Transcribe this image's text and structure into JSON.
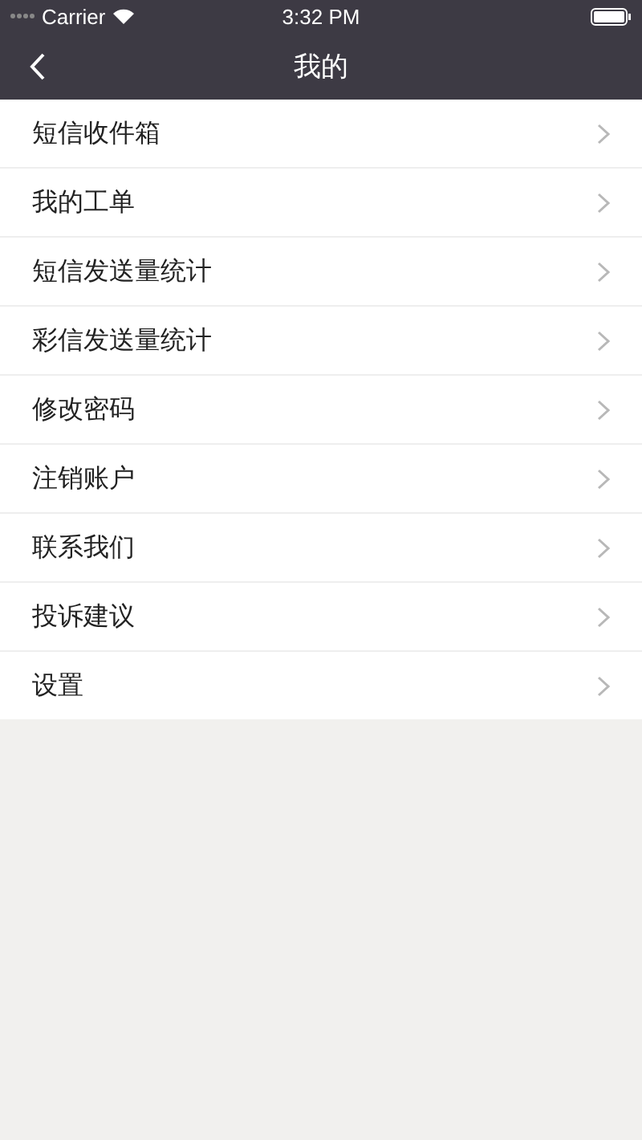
{
  "status_bar": {
    "carrier": "Carrier",
    "time": "3:32 PM"
  },
  "nav": {
    "title": "我的"
  },
  "menu": [
    {
      "label": "短信收件箱"
    },
    {
      "label": "我的工单"
    },
    {
      "label": "短信发送量统计"
    },
    {
      "label": "彩信发送量统计"
    },
    {
      "label": "修改密码"
    },
    {
      "label": "注销账户"
    },
    {
      "label": "联系我们"
    },
    {
      "label": "投诉建议"
    },
    {
      "label": "设置"
    }
  ]
}
